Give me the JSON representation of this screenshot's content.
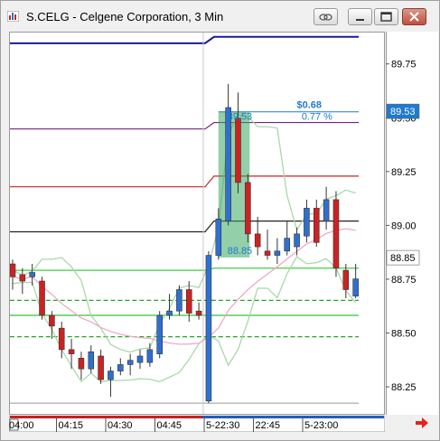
{
  "window": {
    "title": "S.CELG - Celgene Corporation, 3 Min",
    "buttons": [
      "link",
      "minimize",
      "restore",
      "close"
    ]
  },
  "chart_data": {
    "type": "candlestick",
    "ylim": [
      88.12,
      89.9
    ],
    "yticks": [
      "89.75",
      "89.50",
      "89.25",
      "89.00",
      "88.75",
      "88.50",
      "88.25"
    ],
    "xticks": [
      "04:00",
      "04:15",
      "04:30",
      "04:45",
      "5-22:30",
      "22:45",
      "5-23:00"
    ],
    "price_badges": [
      {
        "value": "89.53",
        "bg": "#1f7ad0",
        "fg": "#ffffff"
      },
      {
        "value": "88.85",
        "bg": "#ffffff",
        "fg": "#000000"
      }
    ],
    "measure": {
      "change": "$0.68",
      "percent": "0.77 %",
      "high": "89.53",
      "low": "88.85"
    },
    "candles": [
      {
        "o": 88.82,
        "h": 88.84,
        "l": 88.7,
        "c": 88.76
      },
      {
        "o": 88.77,
        "h": 88.8,
        "l": 88.68,
        "c": 88.74
      },
      {
        "o": 88.76,
        "h": 88.82,
        "l": 88.72,
        "c": 88.78
      },
      {
        "o": 88.74,
        "h": 88.76,
        "l": 88.56,
        "c": 88.58
      },
      {
        "o": 88.58,
        "h": 88.6,
        "l": 88.47,
        "c": 88.53
      },
      {
        "o": 88.52,
        "h": 88.55,
        "l": 88.38,
        "c": 88.42
      },
      {
        "o": 88.42,
        "h": 88.47,
        "l": 88.33,
        "c": 88.4
      },
      {
        "o": 88.38,
        "h": 88.41,
        "l": 88.28,
        "c": 88.33
      },
      {
        "o": 88.33,
        "h": 88.44,
        "l": 88.31,
        "c": 88.41
      },
      {
        "o": 88.39,
        "h": 88.42,
        "l": 88.26,
        "c": 88.28
      },
      {
        "o": 88.28,
        "h": 88.34,
        "l": 88.2,
        "c": 88.32
      },
      {
        "o": 88.32,
        "h": 88.38,
        "l": 88.3,
        "c": 88.35
      },
      {
        "o": 88.35,
        "h": 88.4,
        "l": 88.3,
        "c": 88.37
      },
      {
        "o": 88.36,
        "h": 88.42,
        "l": 88.33,
        "c": 88.39
      },
      {
        "o": 88.36,
        "h": 88.45,
        "l": 88.34,
        "c": 88.42
      },
      {
        "o": 88.4,
        "h": 88.6,
        "l": 88.38,
        "c": 88.58
      },
      {
        "o": 88.58,
        "h": 88.68,
        "l": 88.56,
        "c": 88.6
      },
      {
        "o": 88.6,
        "h": 88.72,
        "l": 88.58,
        "c": 88.7
      },
      {
        "o": 88.7,
        "h": 88.74,
        "l": 88.55,
        "c": 88.59
      },
      {
        "o": 88.6,
        "h": 88.64,
        "l": 88.56,
        "c": 88.58
      },
      {
        "o": 88.18,
        "h": 88.88,
        "l": 88.17,
        "c": 88.86
      },
      {
        "o": 88.86,
        "h": 89.08,
        "l": 88.84,
        "c": 89.03
      },
      {
        "o": 89.02,
        "h": 89.66,
        "l": 89.0,
        "c": 89.55
      },
      {
        "o": 89.5,
        "h": 89.62,
        "l": 89.15,
        "c": 89.2
      },
      {
        "o": 89.2,
        "h": 89.24,
        "l": 88.92,
        "c": 88.96
      },
      {
        "o": 88.96,
        "h": 89.04,
        "l": 88.86,
        "c": 88.9
      },
      {
        "o": 88.88,
        "h": 88.98,
        "l": 88.84,
        "c": 88.86
      },
      {
        "o": 88.86,
        "h": 88.94,
        "l": 88.82,
        "c": 88.88
      },
      {
        "o": 88.88,
        "h": 89.02,
        "l": 88.86,
        "c": 88.94
      },
      {
        "o": 88.9,
        "h": 88.99,
        "l": 88.86,
        "c": 88.96
      },
      {
        "o": 88.95,
        "h": 89.12,
        "l": 88.92,
        "c": 89.08
      },
      {
        "o": 89.08,
        "h": 89.12,
        "l": 88.9,
        "c": 88.92
      },
      {
        "o": 89.02,
        "h": 89.18,
        "l": 88.98,
        "c": 89.12
      },
      {
        "o": 89.12,
        "h": 89.16,
        "l": 88.76,
        "c": 88.8
      },
      {
        "o": 88.79,
        "h": 88.82,
        "l": 88.66,
        "c": 88.7
      },
      {
        "o": 88.67,
        "h": 88.82,
        "l": 88.66,
        "c": 88.75
      }
    ],
    "pivot_levels": [
      {
        "from": 89.85,
        "to": 89.88,
        "color": "#1a1aa0"
      },
      {
        "from": 89.45,
        "to": 89.48,
        "color": "#7a1e7a"
      },
      {
        "from": 89.18,
        "to": 89.23,
        "color": "#cc2222"
      },
      {
        "from": 88.97,
        "to": 89.02,
        "color": "#222222"
      },
      {
        "from": 88.79,
        "to": 88.8,
        "color": "#44cc44"
      },
      {
        "from": 88.58,
        "to": 88.58,
        "color": "#22bb22"
      },
      {
        "from": 88.48,
        "to": 88.48,
        "color": "#22aa22"
      },
      {
        "from": 88.65,
        "to": 88.65,
        "color": "#22aa22"
      }
    ],
    "colors": {
      "up": "#2f6fd0",
      "down": "#cc2222",
      "band": "#a8d8a8",
      "ma": "#f0a8c8",
      "highlight": "#3aa860"
    }
  }
}
